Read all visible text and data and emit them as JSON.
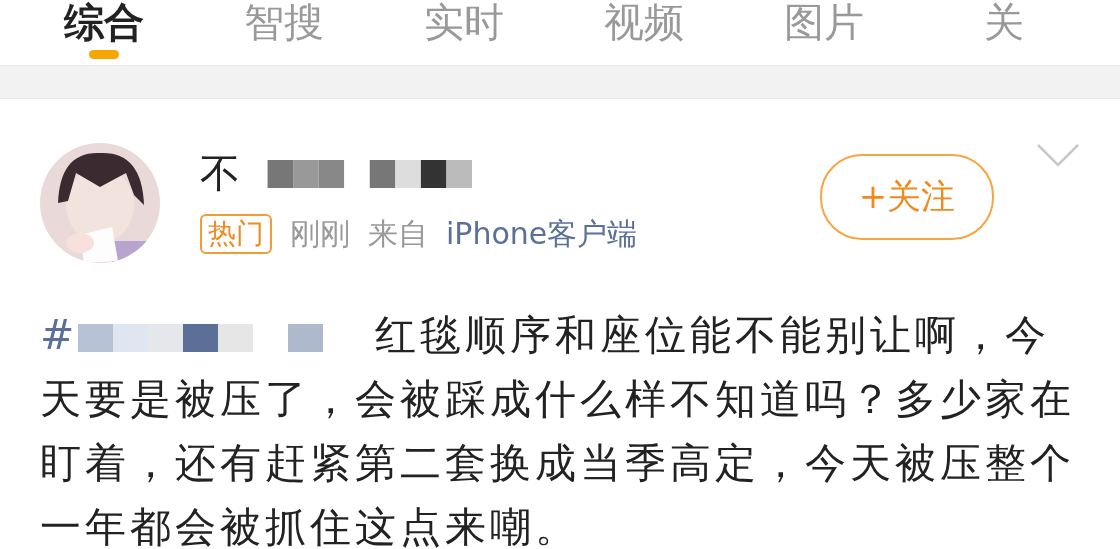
{
  "tabs": [
    {
      "label": "综合",
      "selected": true
    },
    {
      "label": "智搜",
      "selected": false
    },
    {
      "label": "实时",
      "selected": false
    },
    {
      "label": "视频",
      "selected": false
    },
    {
      "label": "图片",
      "selected": false
    },
    {
      "label": "关",
      "selected": false
    }
  ],
  "post": {
    "author": {
      "name_visible": "不"
    },
    "badge": "热门",
    "time": "刚刚",
    "source_prefix": "来自",
    "source": "iPhone客户端",
    "follow_button": "+关注",
    "hashtag_prefix": "#",
    "text": "红毯顺序和座位能不能别让啊，今天要是被压了，会被踩成什么样不知道吗？多少家在盯着，还有赶紧第二套换成当季高定，今天被压整个一年都会被抓住这点来嘲。"
  }
}
